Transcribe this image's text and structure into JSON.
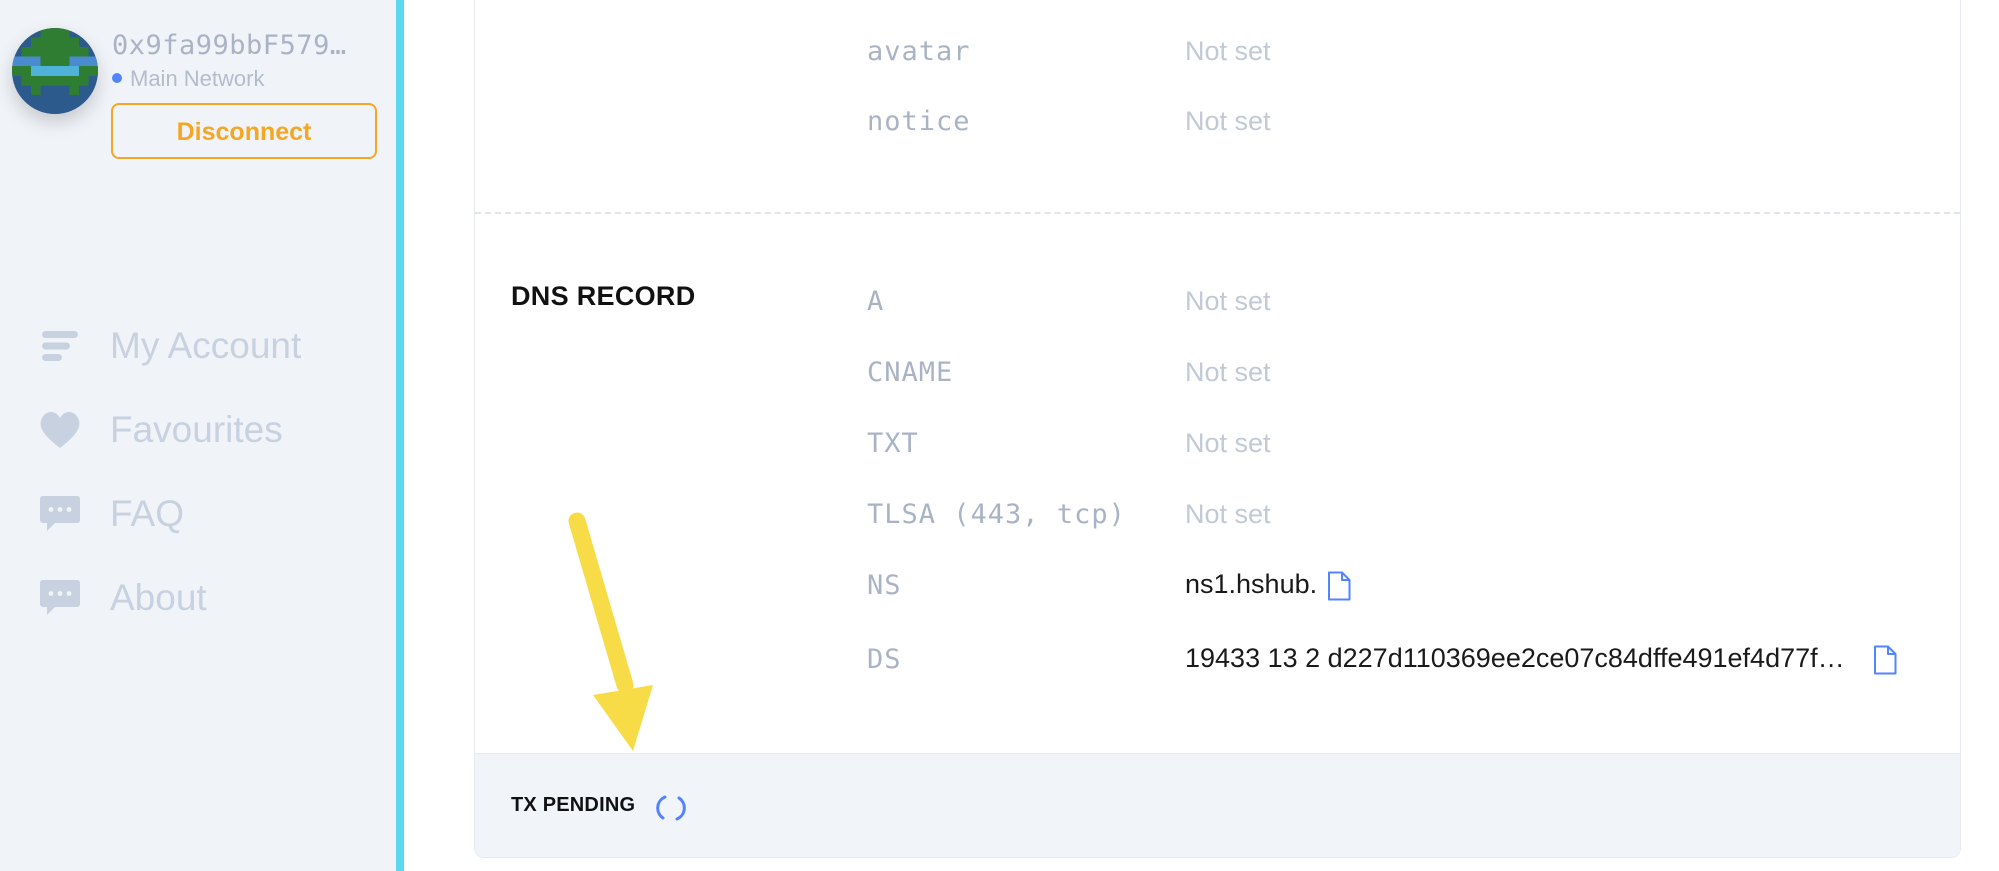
{
  "account": {
    "address": "0x9fa99bbF579…",
    "network": "Main Network",
    "disconnect_label": "Disconnect"
  },
  "nav": {
    "items": [
      {
        "label": "My Account",
        "icon": "list-icon"
      },
      {
        "label": "Favourites",
        "icon": "heart-icon"
      },
      {
        "label": "FAQ",
        "icon": "chat-bubble-icon"
      },
      {
        "label": "About",
        "icon": "chat-bubble-icon"
      }
    ]
  },
  "text_records": [
    {
      "key": "avatar",
      "value": "Not set"
    },
    {
      "key": "notice",
      "value": "Not set"
    }
  ],
  "dns": {
    "title": "DNS RECORD",
    "records": [
      {
        "key": "A",
        "value": "Not set"
      },
      {
        "key": "CNAME",
        "value": "Not set"
      },
      {
        "key": "TXT",
        "value": "Not set"
      },
      {
        "key": "TLSA (443, tcp)",
        "value": "Not set"
      },
      {
        "key": "NS",
        "value": "ns1.hshub.",
        "copy_icon": "file-icon"
      },
      {
        "key": "DS",
        "value": "19433 13 2 d227d110369ee2ce07c84dffe491ef4d77f…",
        "copy_icon": "file-icon"
      }
    ]
  },
  "footer": {
    "status": "TX PENDING",
    "spinner_icon": "spinner-icon"
  },
  "colors": {
    "sidebar_bg": "#f0f4f9",
    "sidebar_border": "#5ad8f0",
    "accent_orange": "#f5a623",
    "link_blue": "#5284ff",
    "muted_text": "#aab3c5",
    "annotation_arrow": "#f7dc47"
  }
}
